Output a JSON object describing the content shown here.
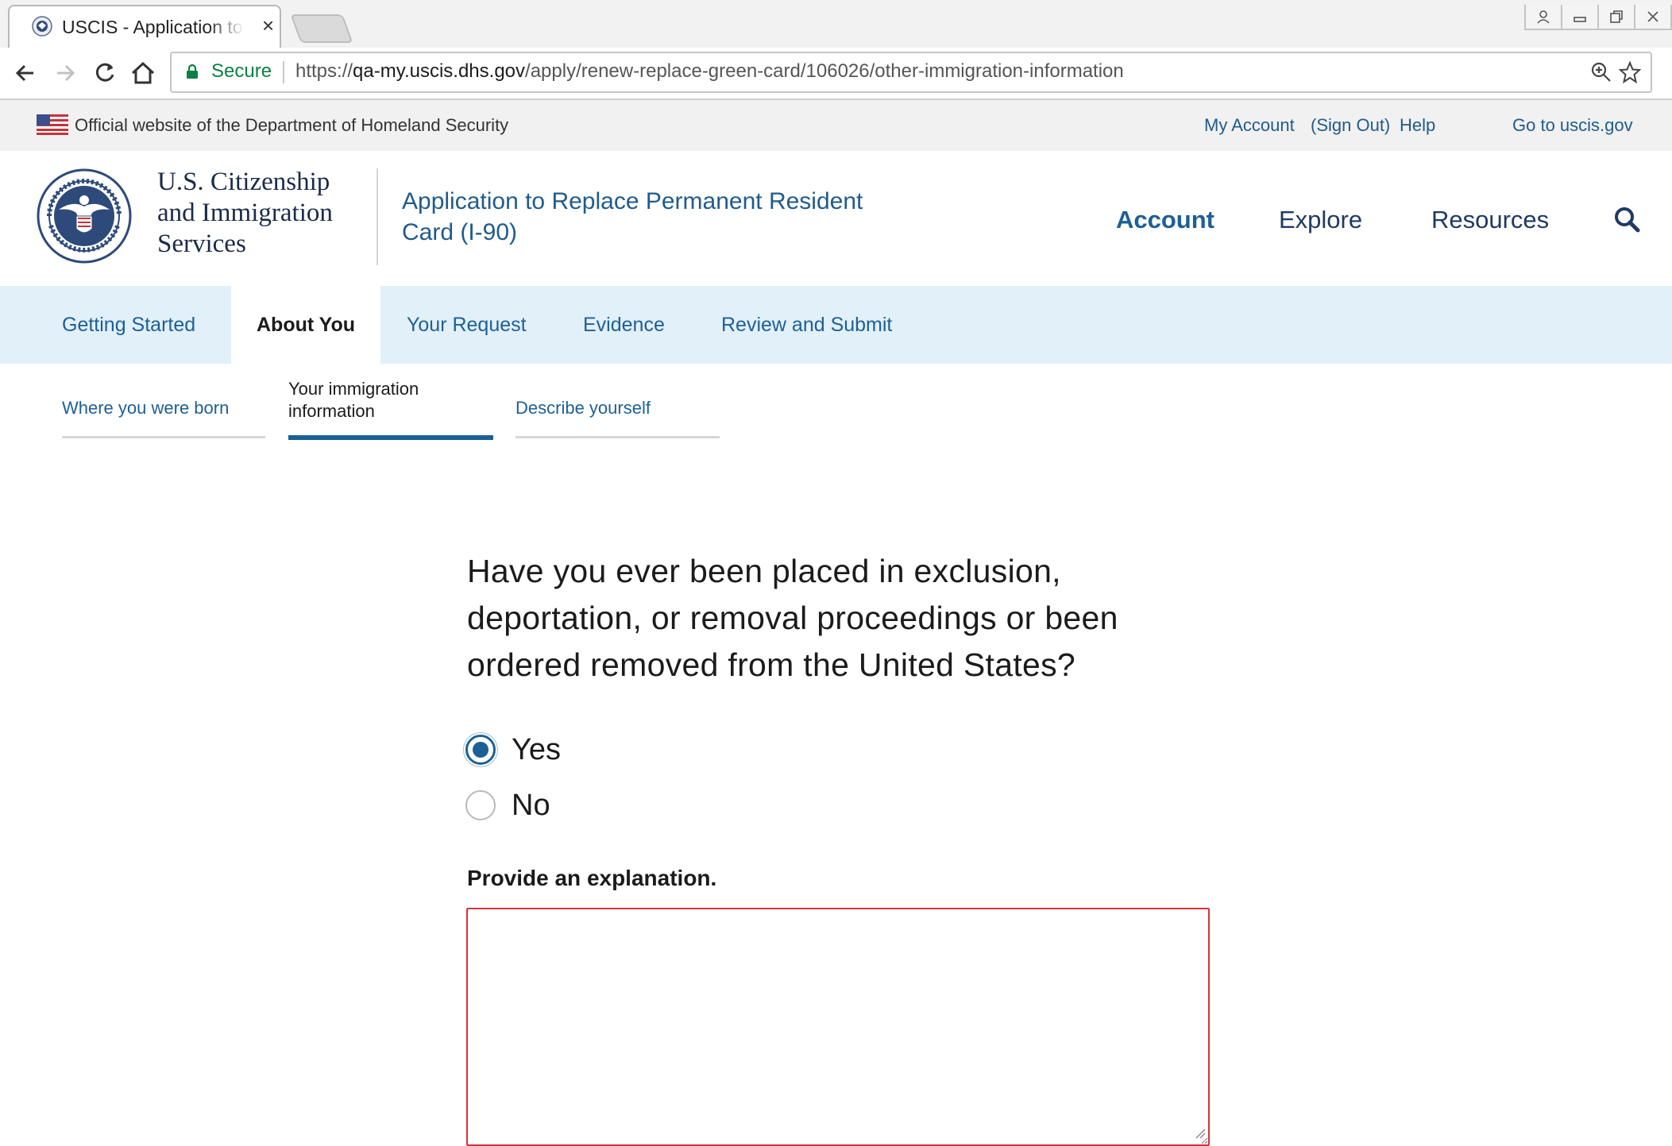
{
  "browser": {
    "tab_title": "USCIS - Application to Re",
    "tab_close": "×",
    "secure_label": "Secure",
    "url_scheme": "https://",
    "url_host": "qa-my.uscis.dhs.gov",
    "url_path": "/apply/renew-replace-green-card/106026/other-immigration-information"
  },
  "gov_banner": {
    "text": "Official website of the Department of Homeland Security",
    "my_account": "My Account",
    "sign_out": "(Sign Out)",
    "help": "Help",
    "go_to": "Go to uscis.gov"
  },
  "header": {
    "agency_line1": "U.S. Citizenship",
    "agency_line2": "and Immigration",
    "agency_line3": "Services",
    "app_title": "Application to Replace Permanent Resident Card (I-90)",
    "nav": [
      "Account",
      "Explore",
      "Resources"
    ],
    "active_nav": "Account"
  },
  "steps": {
    "tabs": [
      "Getting Started",
      "About You",
      "Your Request",
      "Evidence",
      "Review and Submit"
    ],
    "active": "About You"
  },
  "substeps": {
    "items": [
      "Where you were born",
      "Your immigration information",
      "Describe yourself"
    ],
    "active": "Your immigration information"
  },
  "form": {
    "question": "Have you ever been placed in exclusion, deportation, or removal proceedings or been ordered removed from the United States?",
    "options": [
      "Yes",
      "No"
    ],
    "selected": "Yes",
    "explanation_label": "Provide an explanation.",
    "explanation_value": ""
  },
  "colors": {
    "link_blue": "#1d6096",
    "step_bar_bg": "#e2f0fa",
    "error_border": "#d6333c",
    "secure_green": "#0b8043"
  }
}
